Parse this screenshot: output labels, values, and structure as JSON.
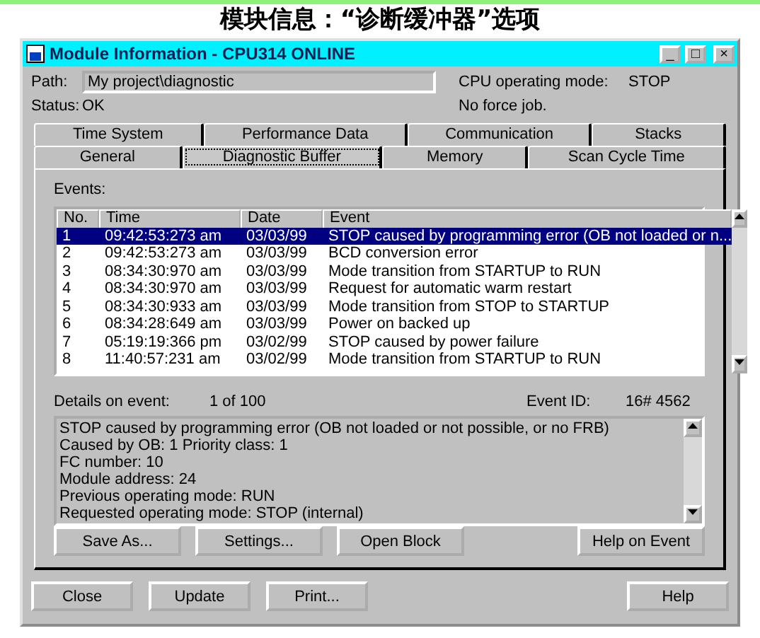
{
  "caption": "模块信息：“诊断缓冲器”选项",
  "window": {
    "title": "Module Information - CPU314  ONLINE",
    "controls": [
      "_",
      "□",
      "×"
    ]
  },
  "info": {
    "path_label": "Path:",
    "path": "My project\\diagnostic",
    "status_label": "Status:",
    "status": "OK",
    "mode_label": "CPU operating mode:",
    "mode": "STOP",
    "force": "No force job."
  },
  "tab_rows": [
    [
      {
        "label": "Time System",
        "selected": false
      },
      {
        "label": "Performance Data",
        "selected": false
      },
      {
        "label": "Communication",
        "selected": false
      },
      {
        "label": "Stacks",
        "selected": false
      }
    ],
    [
      {
        "label": "General",
        "selected": false
      },
      {
        "label": "Diagnostic Buffer",
        "selected": true
      },
      {
        "label": "Memory",
        "selected": false
      },
      {
        "label": "Scan Cycle Time",
        "selected": false
      }
    ]
  ],
  "events_label": "Events:",
  "table": {
    "columns": [
      "No.",
      "Time",
      "Date",
      "Event"
    ],
    "rows": [
      {
        "cells": [
          "1",
          "09:42:53:273 am",
          "03/03/99",
          "STOP caused by programming error (OB not loaded or n..."
        ],
        "selected": true
      },
      {
        "cells": [
          "2",
          "09:42:53:273 am",
          "03/03/99",
          "BCD conversion error"
        ],
        "selected": false
      },
      {
        "cells": [
          "3",
          "08:34:30:970 am",
          "03/03/99",
          "Mode transition from STARTUP to RUN"
        ],
        "selected": false
      },
      {
        "cells": [
          "4",
          "08:34:30:970 am",
          "03/03/99",
          "Request for automatic warm restart"
        ],
        "selected": false
      },
      {
        "cells": [
          "5",
          "08:34:30:933 am",
          "03/03/99",
          "Mode transition from STOP to STARTUP"
        ],
        "selected": false
      },
      {
        "cells": [
          "6",
          "08:34:28:649 am",
          "03/03/99",
          "Power on backed up"
        ],
        "selected": false
      },
      {
        "cells": [
          "7",
          "05:19:19:366 pm",
          "03/02/99",
          "STOP caused by power failure"
        ],
        "selected": false
      },
      {
        "cells": [
          "8",
          "11:40:57:231 am",
          "03/02/99",
          "Mode transition from STARTUP to RUN"
        ],
        "selected": false
      }
    ]
  },
  "details": {
    "label": "Details on event:",
    "position": "1  of  100",
    "id_label": "Event ID:",
    "id": "16# 4562",
    "lines": [
      "STOP caused by programming error (OB not loaded or not possible, or no FRB)",
      "Caused by OB:    1 Priority class:    1",
      "FC number:    10",
      "Module address:     24",
      "Previous operating mode: RUN",
      "Requested operating mode: STOP (internal)"
    ]
  },
  "panel_buttons": [
    "Save As...",
    "Settings...",
    "Open Block",
    "Help on Event"
  ],
  "bottom_buttons": [
    "Close",
    "Update",
    "Print...",
    "Help"
  ]
}
